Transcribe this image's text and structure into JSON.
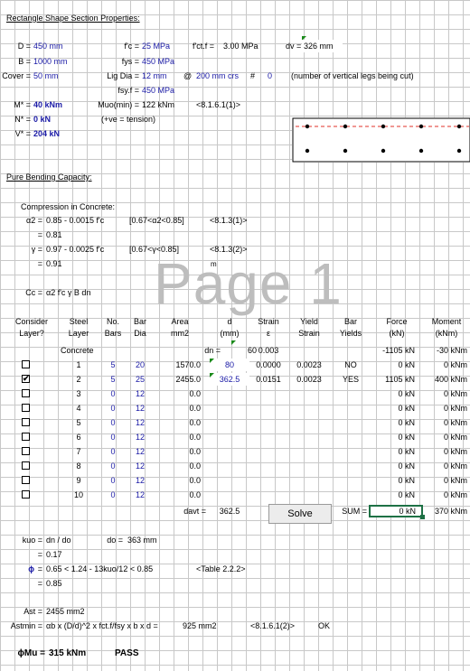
{
  "title": "Rectangle Shape Section Properties:",
  "inputs": {
    "D_label": "D =",
    "D": "450 mm",
    "B_label": "B =",
    "B": "1000 mm",
    "cover_label": "Cover =",
    "cover": "50 mm",
    "M_label": "M* =",
    "M": "40 kNm",
    "N_label": "N* =",
    "N": "0 kN",
    "V_label": "V* =",
    "V": "204 kN",
    "fc_label": "f'c =",
    "fc": "25 MPa",
    "fys_label": "fys =",
    "fys": "450 MPa",
    "lig_label": "Lig Dia =",
    "lig": "12 mm",
    "at": "@",
    "spacing": "200 mm crs",
    "hash": "#",
    "legs": "0",
    "legs_note": "(number of vertical legs being cut)",
    "fsyf_label": "fsy.f =",
    "fsyf": "450 MPa",
    "muo_label": "Muo(min) =",
    "muo": "122 kNm",
    "muo_ref": "<8.1.6.1(1)>",
    "tension_note": "(+ve = tension)",
    "fctf_label": "f'ct.f =",
    "fctf": "3.00 MPa",
    "dv_label": "dv =",
    "dv": "326 mm"
  },
  "pure_bending_title": "Pure Bending Capacity:",
  "compression": {
    "heading": "Compression in Concrete:",
    "a2_label": "α2 =",
    "a2_formula": "0.85 - 0.0015 f'c",
    "a2_range": "[0.67<α2<0.85]",
    "a2_ref": "<8.1.3(1)>",
    "eq1": "=",
    "a2_val": "0.81",
    "g_label": "γ =",
    "g_formula": "0.97 - 0.0025 f'c",
    "g_range": "[0.67<γ<0.85]",
    "g_ref": "<8.1.3(2)>",
    "eq2": "=",
    "g_val": "0.91",
    "cc_label": "Cc =",
    "cc_formula": "α2 f'c γ B dn"
  },
  "watermark": "Page 1",
  "watermark_sup": "m",
  "table": {
    "headers": [
      {
        "l1": "Consider",
        "l2": "Layer?"
      },
      {
        "l1": "Steel",
        "l2": "Layer"
      },
      {
        "l1": "No.",
        "l2": "Bars"
      },
      {
        "l1": "Bar",
        "l2": "Dia"
      },
      {
        "l1": "Area",
        "l2": "mm2"
      },
      {
        "l1": "d",
        "l2": "(mm)"
      },
      {
        "l1": "Strain",
        "l2": "ε"
      },
      {
        "l1": "Yield",
        "l2": "Strain"
      },
      {
        "l1": "Bar",
        "l2": "Yields"
      },
      {
        "l1": "Force",
        "l2": "(kN)"
      },
      {
        "l1": "Moment",
        "l2": "(kNm)"
      }
    ],
    "concrete": {
      "label": "Concrete",
      "dn_label": "dn =",
      "dn": "60",
      "strain": "0.003",
      "force": "-1105 kN",
      "moment": "-30 kNm"
    },
    "rows": [
      {
        "checked": false,
        "layer": "1",
        "bars": "5",
        "dia": "20",
        "area": "1570.0",
        "d": "80",
        "strain": "0.0000",
        "yield": "0.0023",
        "yields": "NO",
        "force": "0 kN",
        "moment": "0 kNm"
      },
      {
        "checked": true,
        "mark": "✔",
        "layer": "2",
        "bars": "5",
        "dia": "25",
        "area": "2455.0",
        "d": "362.5",
        "strain": "0.0151",
        "yield": "0.0023",
        "yields": "YES",
        "force": "1105 kN",
        "moment": "400 kNm"
      },
      {
        "checked": false,
        "layer": "3",
        "bars": "0",
        "dia": "12",
        "area": "0.0",
        "force": "0 kN",
        "moment": "0 kNm"
      },
      {
        "checked": false,
        "layer": "4",
        "bars": "0",
        "dia": "12",
        "area": "0.0",
        "force": "0 kN",
        "moment": "0 kNm"
      },
      {
        "checked": false,
        "layer": "5",
        "bars": "0",
        "dia": "12",
        "area": "0.0",
        "force": "0 kN",
        "moment": "0 kNm"
      },
      {
        "checked": false,
        "layer": "6",
        "bars": "0",
        "dia": "12",
        "area": "0.0",
        "force": "0 kN",
        "moment": "0 kNm"
      },
      {
        "checked": false,
        "layer": "7",
        "bars": "0",
        "dia": "12",
        "area": "0.0",
        "force": "0 kN",
        "moment": "0 kNm"
      },
      {
        "checked": false,
        "layer": "8",
        "bars": "0",
        "dia": "12",
        "area": "0.0",
        "force": "0 kN",
        "moment": "0 kNm"
      },
      {
        "checked": false,
        "layer": "9",
        "bars": "0",
        "dia": "12",
        "area": "0.0",
        "force": "0 kN",
        "moment": "0 kNm"
      },
      {
        "checked": false,
        "layer": "10",
        "bars": "0",
        "dia": "12",
        "area": "0.0",
        "force": "0 kN",
        "moment": "0 kNm"
      }
    ],
    "davt_label": "davt =",
    "davt": "362.5",
    "solve": "Solve",
    "sum_label": "SUM =",
    "sum_force": "0 kN",
    "sum_moment": "370 kNm"
  },
  "ductility": {
    "kuo_label": "kuo =",
    "kuo_formula": "dn / do",
    "do_label": "do =",
    "do": "363 mm",
    "eq1": "=",
    "kuo_val": "0.17",
    "phi": "ϕ",
    "phi_eq": "=",
    "phi_formula": "0.65 < 1.24 - 13kuo/12 < 0.85",
    "phi_ref": "<Table 2.2.2>",
    "eq2": "=",
    "phi_val": "0.85"
  },
  "steel": {
    "ast_label": "Ast =",
    "ast": "2455 mm2",
    "astmin_label": "Astmin =",
    "astmin_formula": "αb x (D/d)^2 x fct.f/fsy x b x d =",
    "astmin": "925 mm2",
    "astmin_ref": "<8.1.6.1(2)>",
    "ok": "OK"
  },
  "result": {
    "label": "ϕMu =",
    "value": "315 kNm",
    "status": "PASS"
  },
  "colors": {
    "input_blue": "#1a1aa6",
    "grid": "#c8c8c8",
    "selection": "#1e7145",
    "dashed_line": "#e0302a",
    "watermark": "#bdbdbd"
  }
}
